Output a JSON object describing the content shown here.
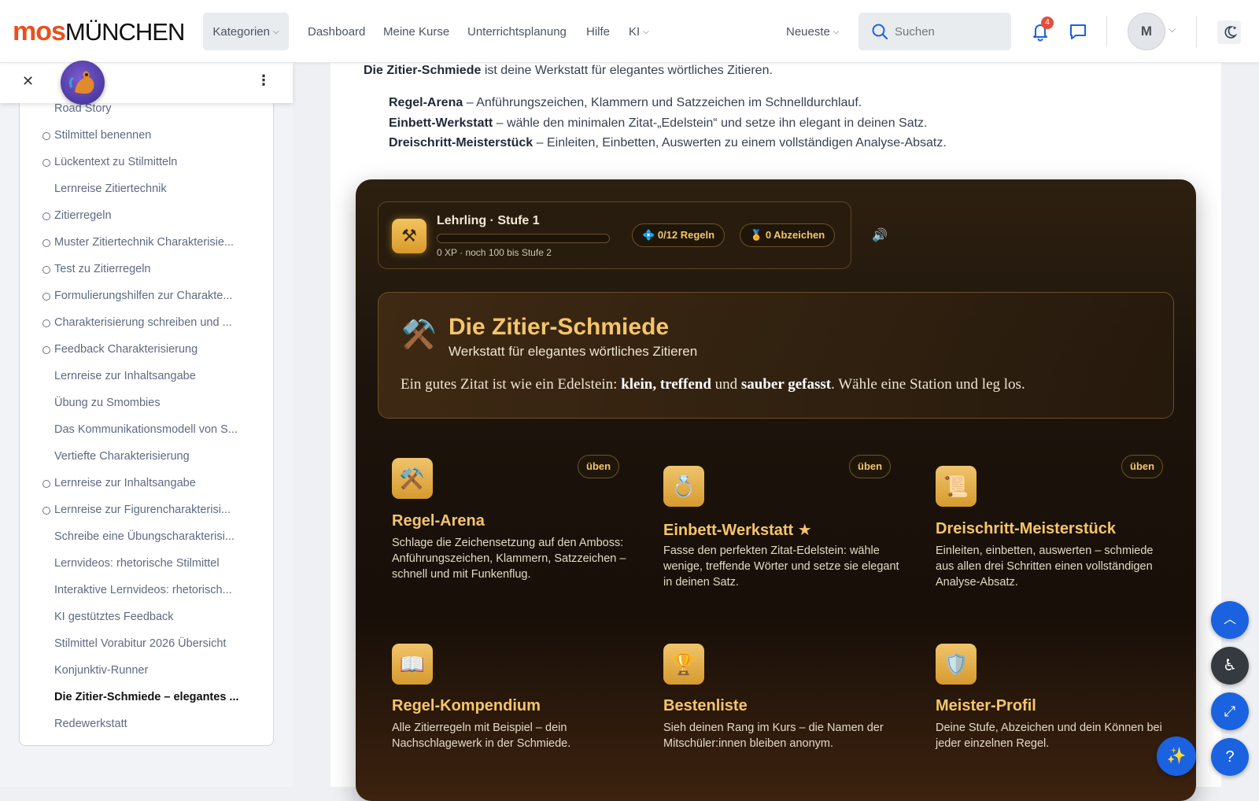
{
  "header": {
    "logo_brand": "mos",
    "logo_city": "MÜNCHEN",
    "nav": [
      "Kategorien",
      "Dashboard",
      "Meine Kurse",
      "Unterrichtsplanung",
      "Hilfe",
      "KI"
    ],
    "sort": "Neueste",
    "search_placeholder": "Suchen",
    "notification_count": "4",
    "avatar_initial": "M"
  },
  "sidebar": {
    "items": [
      {
        "label": "Road Story",
        "dot": false
      },
      {
        "label": "Stilmittel benennen",
        "dot": true
      },
      {
        "label": "Lückentext zu Stilmitteln",
        "dot": true
      },
      {
        "label": "Lernreise Zitiertechnik",
        "dot": false
      },
      {
        "label": "Zitierregeln",
        "dot": true
      },
      {
        "label": "Muster Zitiertechnik Charakterisie...",
        "dot": true
      },
      {
        "label": "Test zu Zitierregeln",
        "dot": true
      },
      {
        "label": "Formulierungshilfen zur Charakte...",
        "dot": true
      },
      {
        "label": "Charakterisierung schreiben und ...",
        "dot": true
      },
      {
        "label": "Feedback Charakterisierung",
        "dot": true
      },
      {
        "label": "Lernreise zur Inhaltsangabe",
        "dot": false
      },
      {
        "label": "Übung zu Smombies",
        "dot": false
      },
      {
        "label": "Das Kommunikationsmodell von S...",
        "dot": false
      },
      {
        "label": "Vertiefte Charakterisierung",
        "dot": false
      },
      {
        "label": "Lernreise zur Inhaltsangabe",
        "dot": true
      },
      {
        "label": "Lernreise zur Figurencharakterisi...",
        "dot": true
      },
      {
        "label": "Schreibe eine Übungscharakterisi...",
        "dot": false
      },
      {
        "label": "Lernvideos: rhetorische Stilmittel",
        "dot": false
      },
      {
        "label": "Interaktive Lernvideos: rhetorisch...",
        "dot": false
      },
      {
        "label": "KI gestütztes Feedback",
        "dot": false
      },
      {
        "label": "Stilmittel Vorabitur 2026 Übersicht",
        "dot": false
      },
      {
        "label": "Konjunktiv-Runner",
        "dot": false
      },
      {
        "label": "Die Zitier-Schmiede – elegantes ...",
        "dot": false,
        "active": true
      },
      {
        "label": "Redewerkstatt",
        "dot": false
      }
    ]
  },
  "intro": {
    "lead_bold": "Die Zitier-Schmiede",
    "lead_rest": " ist deine Werkstatt für elegantes wörtliches Zitieren.",
    "bullets": [
      {
        "bold": "Regel-Arena",
        "rest": " – Anführungszeichen, Klammern und Satzzeichen im Schnelldurchlauf."
      },
      {
        "bold": "Einbett-Werkstatt",
        "rest": " – wähle den minimalen Zitat-„Edelstein“ und setze ihn elegant in deinen Satz."
      },
      {
        "bold": "Dreischritt-Meisterstück",
        "rest": " – Einleiten, Einbetten, Auswerten zu einem vollständigen Analyse-Absatz."
      }
    ]
  },
  "forge": {
    "level": "Lehrling · Stufe 1",
    "xp_text": "0 XP · noch 100 bis Stufe 2",
    "xp_progress": 0,
    "rules_pill": "0/12 Regeln",
    "badges_pill": "0 Abzeichen",
    "hero_title": "Die Zitier-Schmiede",
    "hero_sub": "Werkstatt für elegantes wörtliches Zitieren",
    "hero_t1": "Ein gutes Zitat ist wie ein Edelstein: ",
    "hero_b1": "klein, treffend",
    "hero_t2": " und ",
    "hero_b2": "sauber gefasst",
    "hero_t3": ". Wähle eine Station und leg los.",
    "cards": [
      {
        "icon": "⚒️",
        "title": "Regel-Arena",
        "desc": "Schlage die Zeichensetzung auf den Amboss: Anführungszeichen, Klammern, Satzzeichen – schnell und mit Funkenflug.",
        "tag": "üben"
      },
      {
        "icon": "💍",
        "title": "Einbett-Werkstatt ★",
        "desc": "Fasse den perfekten Zitat-Edelstein: wähle wenige, treffende Wörter und setze sie elegant in deinen Satz.",
        "tag": "üben"
      },
      {
        "icon": "📜",
        "title": "Dreischritt-Meisterstück",
        "desc": "Einleiten, einbetten, auswerten – schmiede aus allen drei Schritten einen vollständigen Analyse-Absatz.",
        "tag": "üben"
      },
      {
        "icon": "📖",
        "title": "Regel-Kompendium",
        "desc": "Alle Zitierregeln mit Beispiel – dein Nachschlagewerk in der Schmiede.",
        "tag": ""
      },
      {
        "icon": "🏆",
        "title": "Bestenliste",
        "desc": "Sieh deinen Rang im Kurs – die Namen der Mitschüler:innen bleiben anonym.",
        "tag": ""
      },
      {
        "icon": "🛡️",
        "title": "Meister-Profil",
        "desc": "Deine Stufe, Abzeichen und dein Können bei jeder einzelnen Regel.",
        "tag": ""
      }
    ]
  }
}
